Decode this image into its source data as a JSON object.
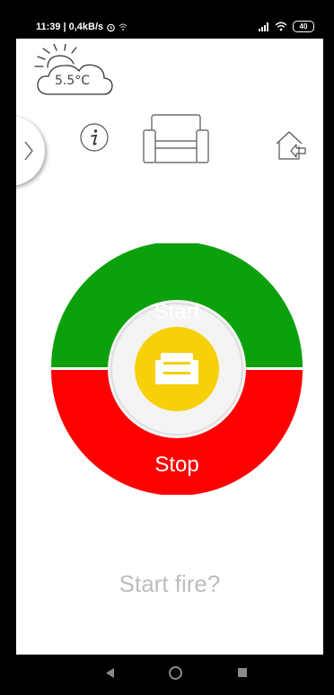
{
  "status_bar": {
    "time": "11:39",
    "network_speed": "0,4kB/s",
    "battery_level": "40",
    "icons": [
      "alarm-icon",
      "wifi-hotspot-icon",
      "signal-icon",
      "wifi-icon",
      "battery-icon"
    ]
  },
  "weather": {
    "temperature": "5.5°C",
    "icon": "sun-cloud-icon"
  },
  "toolbar": {
    "drawer_icon": "chevron-right-icon",
    "info_icon": "info-icon",
    "sofa_icon": "sofa-icon",
    "exit_icon": "house-exit-icon"
  },
  "dial": {
    "start_label": "Start",
    "stop_label": "Stop",
    "center_icon": "sofa-icon",
    "colors": {
      "start": "#0ca10c",
      "stop": "#ff0000",
      "center": "#f7d00a"
    }
  },
  "prompt": "Start fire?",
  "nav_bar": {
    "icons": [
      "back-icon",
      "home-icon",
      "recents-icon"
    ]
  }
}
